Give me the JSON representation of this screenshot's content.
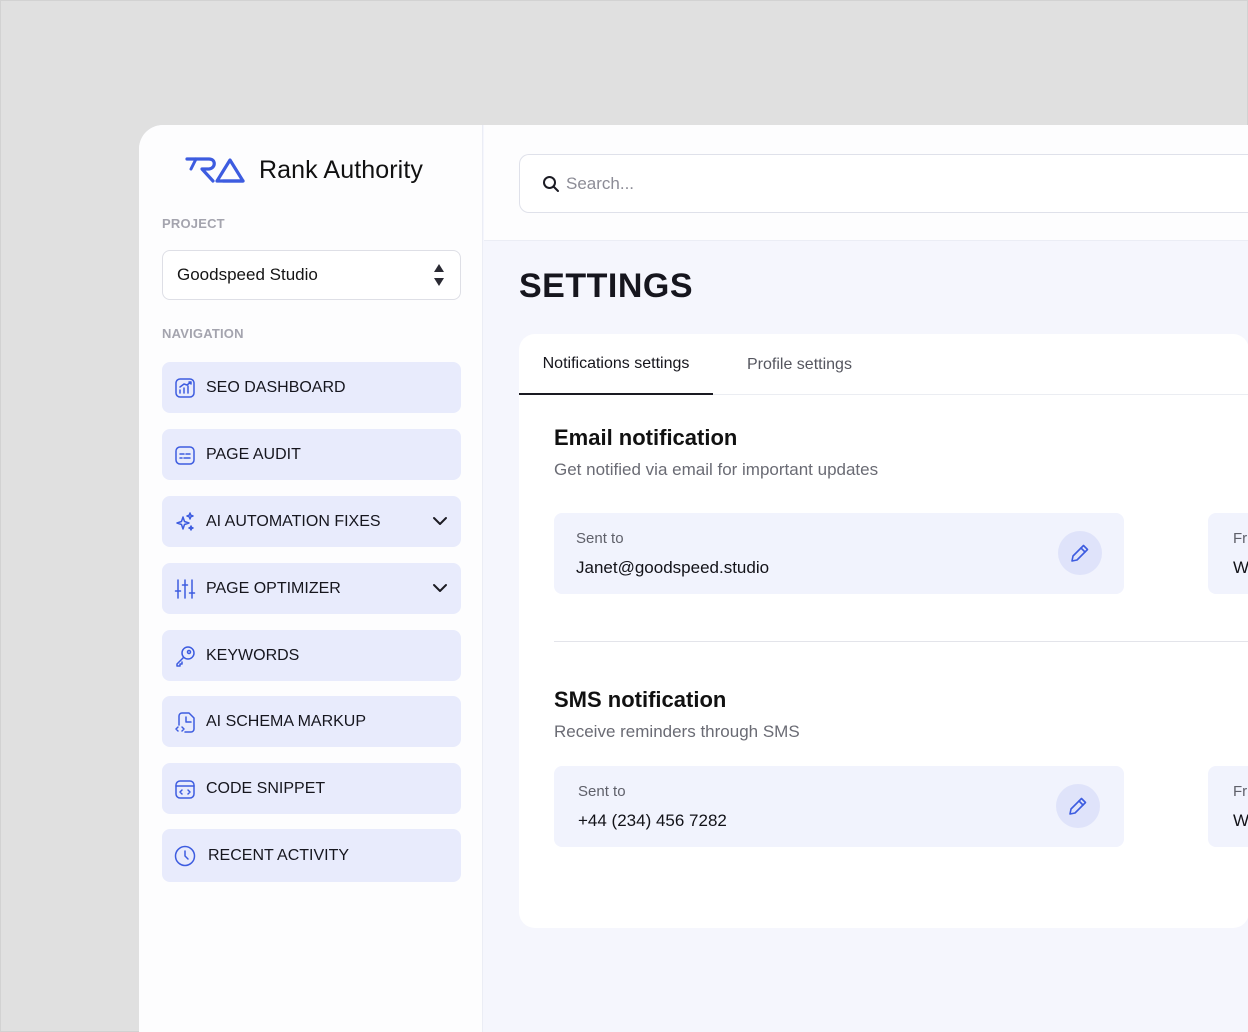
{
  "brand": {
    "name": "Rank Authority",
    "accent": "#3d5ce0"
  },
  "sidebar": {
    "project_label": "PROJECT",
    "project_value": "Goodspeed Studio",
    "navigation_label": "NAVIGATION",
    "items": [
      {
        "label": "SEO DASHBOARD",
        "icon": "chart-icon"
      },
      {
        "label": "PAGE AUDIT",
        "icon": "audit-icon"
      },
      {
        "label": "AI AUTOMATION FIXES",
        "icon": "sparkles-icon",
        "expandable": true
      },
      {
        "label": "PAGE OPTIMIZER",
        "icon": "sliders-icon",
        "expandable": true
      },
      {
        "label": "KEYWORDS",
        "icon": "key-icon"
      },
      {
        "label": "AI SCHEMA MARKUP",
        "icon": "schema-icon"
      },
      {
        "label": "CODE SNIPPET",
        "icon": "code-icon"
      },
      {
        "label": "RECENT ACTIVITY",
        "icon": "clock-icon"
      }
    ]
  },
  "search": {
    "placeholder": "Search..."
  },
  "page": {
    "title": "SETTINGS"
  },
  "tabs": [
    {
      "label": "Notifications settings",
      "active": true
    },
    {
      "label": "Profile settings",
      "active": false
    }
  ],
  "email": {
    "title": "Email notification",
    "subtitle": "Get notified via email for important updates",
    "sent_label": "Sent to",
    "sent_value": "Janet@goodspeed.studio",
    "second_label": "Fr",
    "second_value": "W"
  },
  "sms": {
    "title": "SMS notification",
    "subtitle": "Receive reminders through SMS",
    "sent_label": "Sent to",
    "sent_value": "+44 (234) 456 7282",
    "second_label": "Fr",
    "second_value": "W"
  }
}
